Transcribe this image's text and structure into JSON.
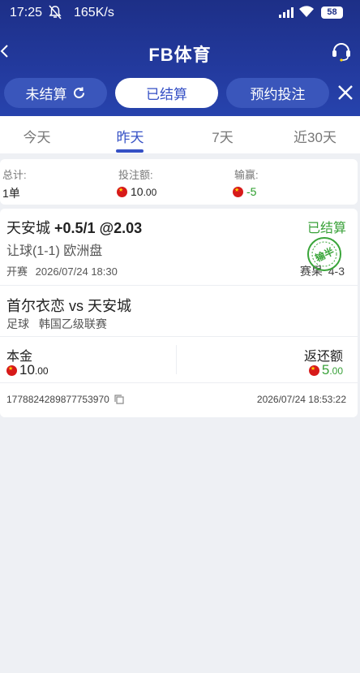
{
  "status_bar": {
    "time": "17:25",
    "speed": "165K/s",
    "battery": "58"
  },
  "header": {
    "title": "FB体育"
  },
  "segments": [
    {
      "label": "未结算"
    },
    {
      "label": "已结算"
    },
    {
      "label": "预约投注"
    }
  ],
  "date_tabs": [
    "今天",
    "昨天",
    "7天",
    "近30天"
  ],
  "summary": {
    "total_label": "总计:",
    "total_value": "1单",
    "stake_label": "投注额:",
    "stake_int": "10",
    "stake_dec": ".00",
    "winloss_label": "输赢:",
    "winloss_value": "-5"
  },
  "bet": {
    "team": "天安城",
    "odds_text": "+0.5/1 @2.03",
    "status": "已结算",
    "market": "让球(1-1) 欧洲盘",
    "start_label": "开赛",
    "start_time": "2026/07/24 18:30",
    "score_label": "赛果",
    "score": "4-3",
    "stamp_text": "输半",
    "match": "首尔衣恋 vs 天安城",
    "sport": "足球",
    "league": "韩国乙级联赛",
    "principal_label": "本金",
    "principal_int": "10",
    "principal_dec": ".00",
    "return_label": "返还额",
    "return_int": "5",
    "return_dec": ".00",
    "order_id": "1778824289877753970",
    "settle_time": "2026/07/24 18:53:22"
  }
}
